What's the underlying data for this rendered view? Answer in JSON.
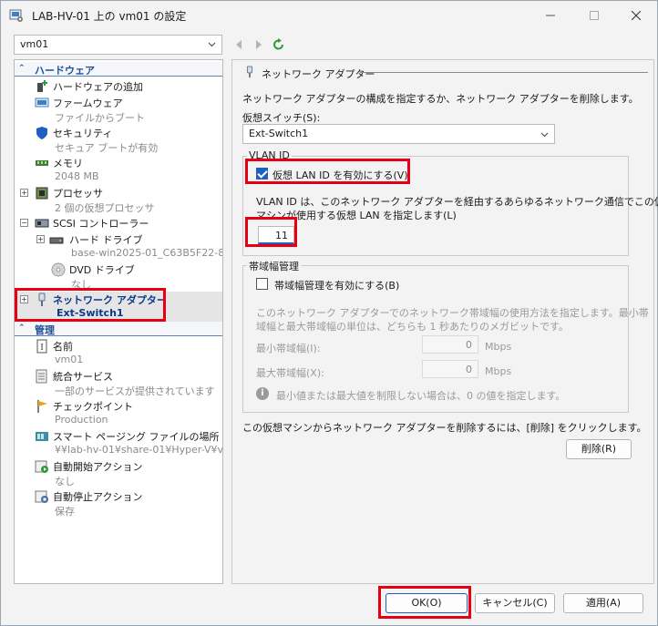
{
  "window": {
    "title": "LAB-HV-01 上の vm01 の設定"
  },
  "vm_select": {
    "value": "vm01"
  },
  "sections": {
    "hardware": "ハードウェア",
    "management": "管理"
  },
  "hardware_items": [
    {
      "name": "ハードウェアの追加",
      "sub": ""
    },
    {
      "name": "ファームウェア",
      "sub": "ファイルからブート"
    },
    {
      "name": "セキュリティ",
      "sub": "セキュア ブートが有効"
    },
    {
      "name": "メモリ",
      "sub": "2048 MB"
    },
    {
      "name": "プロセッサ",
      "sub": "2 個の仮想プロセッサ"
    },
    {
      "name": "SCSI コントローラー",
      "sub": ""
    },
    {
      "name": "ハード ドライブ",
      "sub": "base-win2025-01_C63B5F22-8..."
    },
    {
      "name": "DVD ドライブ",
      "sub": "なし"
    },
    {
      "name": "ネットワーク アダプター",
      "sub": "Ext-Switch1"
    }
  ],
  "management_items": [
    {
      "name": "名前",
      "sub": "vm01"
    },
    {
      "name": "統合サービス",
      "sub": "一部のサービスが提供されています"
    },
    {
      "name": "チェックポイント",
      "sub": "Production"
    },
    {
      "name": "スマート ページング ファイルの場所",
      "sub": "¥¥lab-hv-01¥share-01¥Hyper-V¥v..."
    },
    {
      "name": "自動開始アクション",
      "sub": "なし"
    },
    {
      "name": "自動停止アクション",
      "sub": "保存"
    }
  ],
  "panel": {
    "title": "ネットワーク アダプター",
    "desc": "ネットワーク アダプターの構成を指定するか、ネットワーク アダプターを削除します。",
    "switch_label": "仮想スイッチ(S):",
    "switch_value": "Ext-Switch1",
    "vlan": {
      "group": "VLAN ID",
      "checkbox_label": "仮想 LAN ID を有効にする(V)",
      "checked": true,
      "desc1": "VLAN ID は、このネットワーク アダプターを経由するあらゆるネットワーク通信でこの仮想",
      "desc2": "マシンが使用する仮想 LAN を指定します(L)",
      "value": "11"
    },
    "bandwidth": {
      "group": "帯域幅管理",
      "checkbox_label": "帯域幅管理を有効にする(B)",
      "checked": false,
      "desc1": "このネットワーク アダプターでのネットワーク帯域幅の使用方法を指定します。最小帯",
      "desc2": "域幅と最大帯域幅の単位は、どちらも 1 秒あたりのメガビットです。",
      "min_label": "最小帯域幅(I):",
      "min_value": "0",
      "max_label": "最大帯域幅(X):",
      "max_value": "0",
      "unit": "Mbps",
      "note": "最小値または最大値を制限しない場合は、0 の値を指定します。"
    },
    "remove_desc": "この仮想マシンからネットワーク アダプターを削除するには、[削除] をクリックします。",
    "remove_button": "削除(R)"
  },
  "buttons": {
    "ok": "OK(O)",
    "cancel": "キャンセル(C)",
    "apply": "適用(A)"
  },
  "colors": {
    "highlight": "#e60012",
    "accent": "#1f5fbf",
    "section_text": "#1f4e99"
  }
}
